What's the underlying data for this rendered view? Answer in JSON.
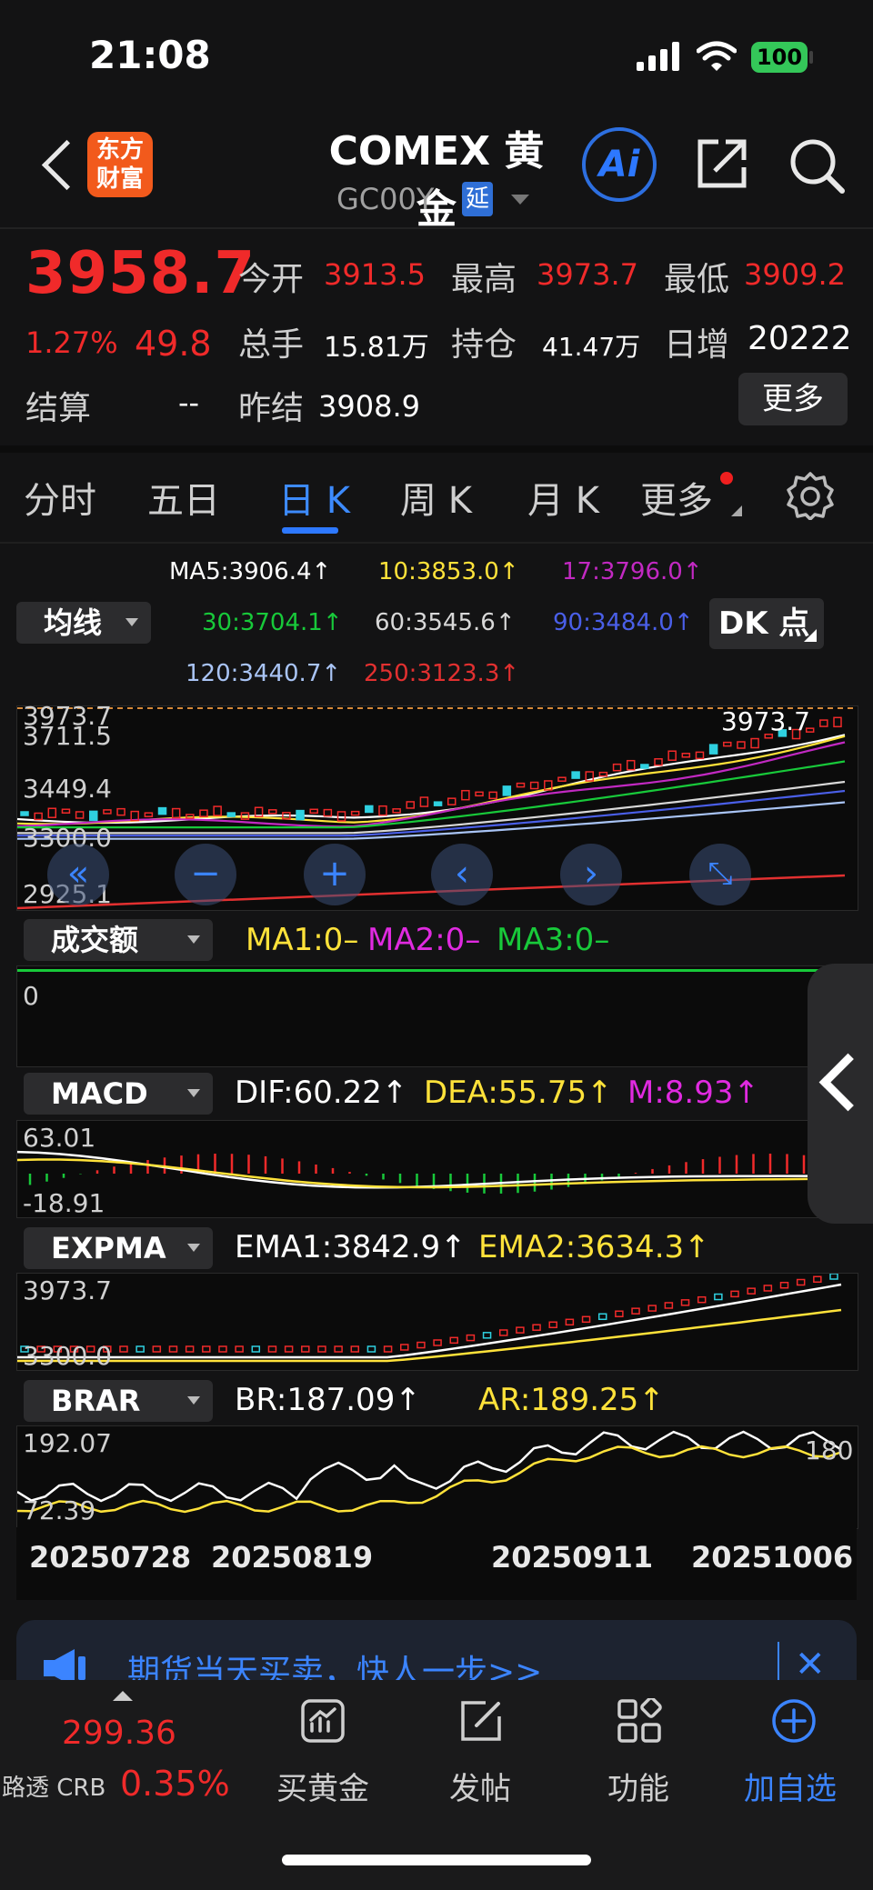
{
  "status_bar": {
    "time": "21:08",
    "battery": "100"
  },
  "header": {
    "logo_text": "东方\n财富",
    "title": "COMEX 黄金",
    "code": "GC00Y",
    "delay_badge": "延",
    "ai_label": "Ai"
  },
  "quote": {
    "price": "3958.7",
    "change_pct": "1.27%",
    "change_abs": "49.8",
    "open_label": "今开",
    "open": "3913.5",
    "high_label": "最高",
    "high": "3973.7",
    "low_label": "最低",
    "low": "3909.2",
    "volume_label": "总手",
    "volume": "15.81万",
    "oi_label": "持仓",
    "oi": "41.47万",
    "daily_inc_label": "日增",
    "daily_inc": "20222",
    "settle_label": "结算",
    "settle": "--",
    "prev_settle_label": "昨结",
    "prev_settle": "3908.9",
    "more_button": "更多"
  },
  "tabs": [
    "分时",
    "五日",
    "日 K",
    "周 K",
    "月 K",
    "更多"
  ],
  "ma_panel": {
    "selector": "均线",
    "dk_button": "DK 点",
    "legend": [
      {
        "label": "MA5:3906.4↑",
        "color": "#ffffff"
      },
      {
        "label": "10:3853.0↑",
        "color": "#ffe23a"
      },
      {
        "label": "17:3796.0↑",
        "color": "#c229c2"
      },
      {
        "label": "30:3704.1↑",
        "color": "#18c93a"
      },
      {
        "label": "60:3545.6↑",
        "color": "#d8d8d8"
      },
      {
        "label": "90:3484.0↑",
        "color": "#4a5fe8"
      },
      {
        "label": "120:3440.7↑",
        "color": "#a9c4f5"
      },
      {
        "label": "250:3123.3↑",
        "color": "#e23030"
      }
    ],
    "axis_labels": [
      "3973.7",
      "3711.5",
      "3449.4",
      "3300.0",
      "2925.1"
    ],
    "high_marker": "3973.7"
  },
  "volume_panel": {
    "selector": "成交额",
    "legend": [
      {
        "label": "MA1:0–",
        "color": "#ffe23a"
      },
      {
        "label": "MA2:0–",
        "color": "#e02ae0"
      },
      {
        "label": "MA3:0–",
        "color": "#18c93a"
      }
    ],
    "axis_label": "0"
  },
  "macd_panel": {
    "selector": "MACD",
    "legend": [
      {
        "label": "DIF:60.22↑",
        "color": "#ffffff"
      },
      {
        "label": "DEA:55.75↑",
        "color": "#ffe23a"
      },
      {
        "label": "M:8.93↑",
        "color": "#e02ae0"
      }
    ],
    "axis_top": "63.01",
    "axis_bottom": "-18.91"
  },
  "expma_panel": {
    "selector": "EXPMA",
    "legend": [
      {
        "label": "EMA1:3842.9↑",
        "color": "#ffffff"
      },
      {
        "label": "EMA2:3634.3↑",
        "color": "#ffe23a"
      }
    ],
    "axis_top": "3973.7",
    "axis_bottom": "3300.0"
  },
  "brar_panel": {
    "selector": "BRAR",
    "legend": [
      {
        "label": "BR:187.09↑",
        "color": "#ffffff"
      },
      {
        "label": "AR:189.25↑",
        "color": "#ffe23a"
      }
    ],
    "axis_top": "192.07",
    "axis_bottom": "72.39",
    "axis_right": "180"
  },
  "dates": [
    "20250728",
    "20250819",
    "20250911",
    "20251006"
  ],
  "banner": {
    "text": "期货当天买卖，快人一步>>",
    "close": "✕"
  },
  "bottom_bar": {
    "crb_price": "299.36",
    "crb_name": "路透 CRB",
    "crb_pct": "0.35%",
    "items": [
      "买黄金",
      "发帖",
      "功能",
      "加自选"
    ]
  },
  "colors": {
    "accent": "#2d78ff",
    "up": "#f02a2a",
    "down": "#18c93a"
  }
}
